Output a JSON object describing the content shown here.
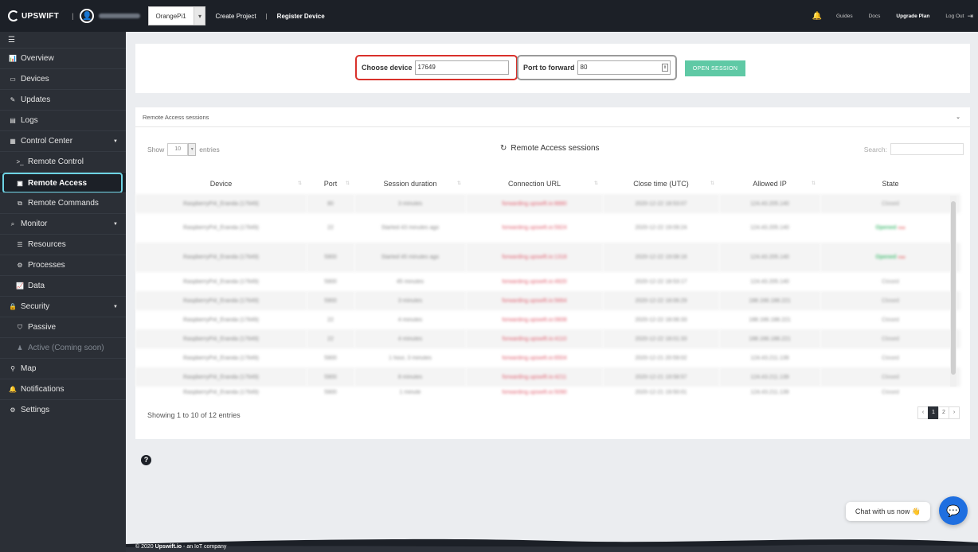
{
  "topbar": {
    "brand": "UPSWIFT",
    "separator": "|",
    "project": "OrangePi1",
    "create_project": "Create Project",
    "divider": "|",
    "register_device": "Register Device",
    "guides": "Guides",
    "docs": "Docs",
    "upgrade": "Upgrade Plan",
    "logout": "Log Out"
  },
  "sidebar": {
    "overview": "Overview",
    "devices": "Devices",
    "updates": "Updates",
    "logs": "Logs",
    "control_center": "Control Center",
    "remote_control": "Remote Control",
    "remote_access": "Remote Access",
    "remote_commands": "Remote Commands",
    "monitor": "Monitor",
    "resources": "Resources",
    "processes": "Processes",
    "data": "Data",
    "security": "Security",
    "passive": "Passive",
    "active": "Active (Coming soon)",
    "map": "Map",
    "notifications": "Notifications",
    "settings": "Settings"
  },
  "session_form": {
    "device_label": "Choose device",
    "device_value": "17649",
    "port_label": "Port to forward",
    "port_value": "80",
    "open_button": "OPEN SESSION"
  },
  "sessions_panel": {
    "title": "Remote Access sessions",
    "show": "Show",
    "page_size": "10",
    "entries": "entries",
    "center_title": "Remote Access sessions",
    "search_label": "Search:",
    "columns": [
      "Device",
      "Port",
      "Session duration",
      "Connection URL",
      "Close time (UTC)",
      "Allowed IP",
      "State"
    ],
    "rows": [
      {
        "device": "RaspberryPi4_Eranda (17649)",
        "port": "80",
        "duration": "3 minutes",
        "url": "forwarding.upswift.io:8880",
        "close": "2020-12-22 18:53:07",
        "ip": "124.43.205.140",
        "state": "Closed",
        "tag": ""
      },
      {
        "device": "RaspberryPi4_Eranda (17649)",
        "port": "22",
        "duration": "Started 43 minutes ago",
        "url": "forwarding.upswift.io:5924",
        "close": "2020-12-22 19:09:24",
        "ip": "124.43.205.140",
        "state": "Opened",
        "tag": "now"
      },
      {
        "device": "RaspberryPi4_Eranda (17649)",
        "port": "5900",
        "duration": "Started 45 minutes ago",
        "url": "forwarding.upswift.io:1318",
        "close": "2020-12-22 19:08:16",
        "ip": "124.43.205.140",
        "state": "Opened",
        "tag": "now"
      },
      {
        "device": "RaspberryPi4_Eranda (17649)",
        "port": "5900",
        "duration": "45 minutes",
        "url": "forwarding.upswift.io:4920",
        "close": "2020-12-22 18:53:17",
        "ip": "124.43.205.140",
        "state": "Closed",
        "tag": ""
      },
      {
        "device": "RaspberryPi4_Eranda (17649)",
        "port": "5900",
        "duration": "3 minutes",
        "url": "forwarding.upswift.io:5664",
        "close": "2020-12-22 18:06:29",
        "ip": "188.166.188.221",
        "state": "Closed",
        "tag": ""
      },
      {
        "device": "RaspberryPi4_Eranda (17649)",
        "port": "22",
        "duration": "4 minutes",
        "url": "forwarding.upswift.io:0608",
        "close": "2020-12-22 18:06:33",
        "ip": "188.166.188.221",
        "state": "Closed",
        "tag": ""
      },
      {
        "device": "RaspberryPi4_Eranda (17649)",
        "port": "22",
        "duration": "4 minutes",
        "url": "forwarding.upswift.io:4110",
        "close": "2020-12-22 18:01:33",
        "ip": "188.166.188.221",
        "state": "Closed",
        "tag": ""
      },
      {
        "device": "RaspberryPi4_Eranda (17649)",
        "port": "5900",
        "duration": "1 hour, 3 minutes",
        "url": "forwarding.upswift.io:6504",
        "close": "2020-12-21 20:59:02",
        "ip": "124.43.211.139",
        "state": "Closed",
        "tag": ""
      },
      {
        "device": "RaspberryPi4_Eranda (17649)",
        "port": "5900",
        "duration": "8 minutes",
        "url": "forwarding.upswift.io:4211",
        "close": "2020-12-21 19:58:57",
        "ip": "124.43.211.139",
        "state": "Closed",
        "tag": ""
      },
      {
        "device": "RaspberryPi4_Eranda (17649)",
        "port": "5900",
        "duration": "1 minute",
        "url": "forwarding.upswift.io:5090",
        "close": "2020-12-21 19:50:01",
        "ip": "124.43.211.139",
        "state": "Closed",
        "tag": ""
      }
    ],
    "info": "Showing 1 to 10 of 12 entries",
    "pages": [
      "‹",
      "1",
      "2",
      "›"
    ]
  },
  "footer": {
    "prefix": "© 2020",
    "brand": "Upswift.io",
    "suffix": "- an IoT company"
  },
  "chat": {
    "label": "Chat with us now 👋"
  }
}
